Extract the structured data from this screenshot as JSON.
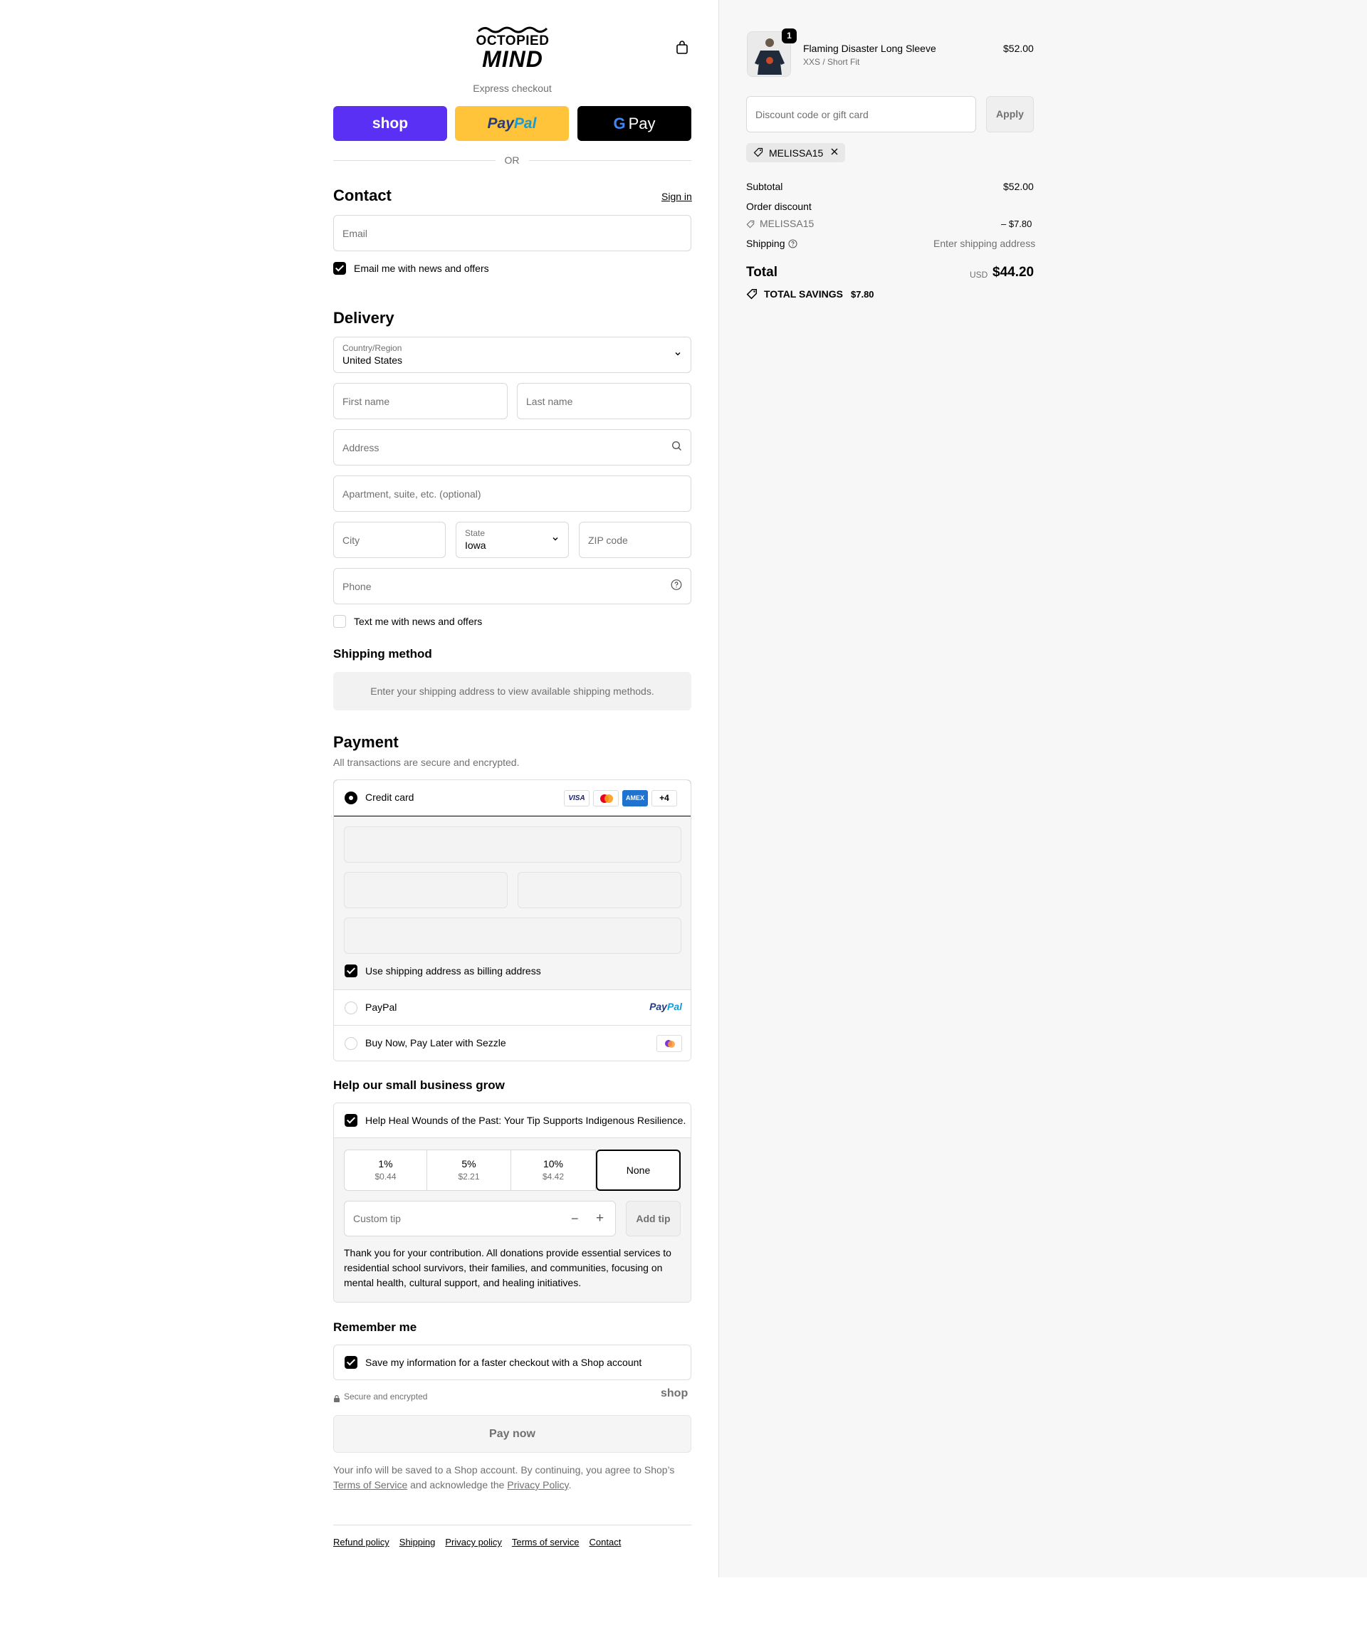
{
  "brand": {
    "logo_line1": "OCTOPIED",
    "logo_line2": "MIND"
  },
  "express": {
    "label": "Express checkout",
    "shop_pay": "shop",
    "paypal_pay": "Pay",
    "paypal_pal": "Pal",
    "gpay": "Pay",
    "or": "OR"
  },
  "contact": {
    "title": "Contact",
    "sign_in": "Sign in",
    "email_placeholder": "Email",
    "news_label": "Email me with news and offers"
  },
  "delivery": {
    "title": "Delivery",
    "country_label": "Country/Region",
    "country_value": "United States",
    "first_name": "First name",
    "last_name": "Last name",
    "address": "Address",
    "apartment": "Apartment, suite, etc. (optional)",
    "city": "City",
    "state_label": "State",
    "state_value": "Iowa",
    "zip": "ZIP code",
    "phone": "Phone",
    "text_label": "Text me with news and offers"
  },
  "shipping_method": {
    "title": "Shipping method",
    "notice": "Enter your shipping address to view available shipping methods."
  },
  "payment": {
    "title": "Payment",
    "subtitle": "All transactions are secure and encrypted.",
    "credit_card": "Credit card",
    "visa": "VISA",
    "amex": "AMEX",
    "more_cards": "+4",
    "billing_label": "Use shipping address as billing address",
    "paypal": "PayPal",
    "paypal_logo_pay": "Pay",
    "paypal_logo_pal": "Pal",
    "sezzle": "Buy Now, Pay Later with Sezzle"
  },
  "tip": {
    "title": "Help our small business grow",
    "checkbox_label": "Help Heal Wounds of the Past: Your Tip Supports Indigenous Resilience.",
    "options": [
      {
        "pct": "1%",
        "amt": "$0.44"
      },
      {
        "pct": "5%",
        "amt": "$2.21"
      },
      {
        "pct": "10%",
        "amt": "$4.42"
      },
      {
        "pct": "None",
        "amt": ""
      }
    ],
    "custom_placeholder": "Custom tip",
    "add_tip": "Add tip",
    "thanks": "Thank you for your contribution. All donations provide essential services to residential school survivors, their families, and communities, focusing on mental health, cultural support, and healing initiatives."
  },
  "remember": {
    "title": "Remember me",
    "save_label": "Save my information for a faster checkout with a Shop account",
    "secure": "Secure and encrypted",
    "shop_logo": "shop"
  },
  "pay_now": "Pay now",
  "legal": {
    "text1": "Your info will be saved to a Shop account. By continuing, you agree to Shop’s",
    "tos": "Terms of Service",
    "text2": "and acknowledge the",
    "privacy": "Privacy Policy",
    "text3": "."
  },
  "footer_links": [
    "Refund policy",
    "Shipping",
    "Privacy policy",
    "Terms of service",
    "Contact"
  ],
  "summary": {
    "item_name": "Flaming Disaster Long Sleeve",
    "item_variant": "XXS / Short Fit",
    "item_price": "$52.00",
    "item_qty": "1",
    "discount_placeholder": "Discount code or gift card",
    "apply": "Apply",
    "code_tag": "MELISSA15",
    "subtotal_label": "Subtotal",
    "subtotal_value": "$52.00",
    "order_discount_label": "Order discount",
    "discount_code": "MELISSA15",
    "discount_value": "– $7.80",
    "shipping_label": "Shipping",
    "shipping_value": "Enter shipping address",
    "total_label": "Total",
    "currency": "USD",
    "total_value": "$44.20",
    "savings_label": "TOTAL SAVINGS",
    "savings_value": "$7.80"
  }
}
